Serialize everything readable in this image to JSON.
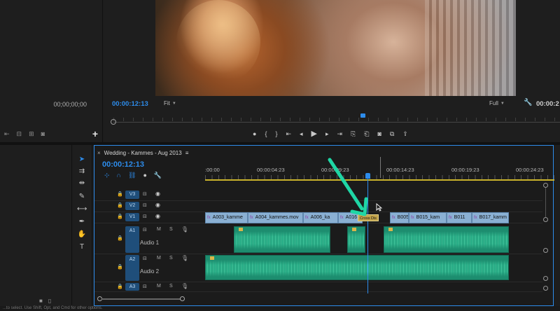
{
  "source": {
    "timecode": "00;00;00;00",
    "toolbar_icons": [
      "mark-in-icon",
      "insert-icon",
      "overwrite-icon",
      "export-frame-icon"
    ],
    "add_label": "+"
  },
  "program": {
    "timecode": "00:00:12:13",
    "zoom": "Fit",
    "quality": "Full",
    "timecode_right": "00:00:2",
    "playhead_fraction": 0.56
  },
  "transport": {
    "icons": [
      "add-marker-icon",
      "mark-in-icon",
      "mark-out-icon",
      "go-to-in-icon",
      "step-back-icon",
      "play-icon",
      "step-forward-icon",
      "go-to-out-icon",
      "lift-icon",
      "extract-icon",
      "export-frame-icon",
      "compare-icon",
      "share-icon"
    ],
    "glyphs": [
      "●",
      "{",
      "}",
      "⇤",
      "◂",
      "▶",
      "▸",
      "⇥",
      "⎘",
      "⎗",
      "◙",
      "⧉",
      "⇪"
    ]
  },
  "tools": [
    "selection-tool",
    "track-select-tool",
    "ripple-edit-tool",
    "razor-tool",
    "slip-tool",
    "pen-tool",
    "hand-tool",
    "type-tool"
  ],
  "tool_glyphs": [
    "➤",
    "⇉",
    "⇹",
    "✎",
    "⟷",
    "✒",
    "✋",
    "T"
  ],
  "timeline": {
    "sequence_name": "Wedding - Kammes - Aug 2013",
    "close_label": "×",
    "timecode": "00:00:12:13",
    "ruler_labels": [
      ":00:00",
      "00:00:04:23",
      "00:00:09:23",
      "00:00:14:23",
      "00:00:19:23",
      "00:00:24:23"
    ],
    "tracks": {
      "video": [
        {
          "name": "V3"
        },
        {
          "name": "V2"
        },
        {
          "name": "V1"
        }
      ],
      "audio": [
        {
          "name": "A1",
          "label": "Audio 1"
        },
        {
          "name": "A2",
          "label": "Audio 2"
        },
        {
          "name": "A3"
        }
      ],
      "m_label": "M",
      "s_label": "S"
    },
    "video_clips": [
      {
        "label": "A003_kamme"
      },
      {
        "label": "A004_kammes.mov"
      },
      {
        "label": "A006_ka"
      },
      {
        "label": "A016"
      },
      {
        "label": "B005_k"
      },
      {
        "label": "B015_kam"
      },
      {
        "label": "B011"
      },
      {
        "label": "B017_kamm"
      }
    ],
    "fx_label": "fx",
    "transition_label": "Cross Dis",
    "annotation_color": "#1fd6a5"
  },
  "colors": {
    "accent": "#2d8ceb",
    "video_clip": "#8ab0d3",
    "audio_clip": "#1d8d6f",
    "work_area": "#c9b22b"
  },
  "status": {
    "text": "...to select. Use Shift, Opt, and Cmd for other options."
  }
}
